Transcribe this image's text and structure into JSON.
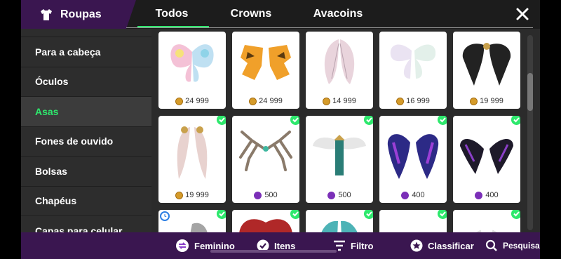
{
  "header": {
    "brand_label": "Roupas",
    "tabs": [
      {
        "label": "Todos",
        "active": true
      },
      {
        "label": "Crowns",
        "active": false
      },
      {
        "label": "Avacoins",
        "active": false
      }
    ],
    "accent_color": "#2ee86d",
    "brand_color": "#3a1650"
  },
  "sidebar": {
    "items": [
      {
        "label": "Para a cabeça",
        "active": false
      },
      {
        "label": "Óculos",
        "active": false
      },
      {
        "label": "Asas",
        "active": true
      },
      {
        "label": "Fones de ouvido",
        "active": false
      },
      {
        "label": "Bolsas",
        "active": false
      },
      {
        "label": "Chapéus",
        "active": false
      },
      {
        "label": "Capas para celular",
        "active": false
      }
    ]
  },
  "items": [
    {
      "price": "24 999",
      "currency": "coin",
      "owned": false,
      "art": "butterfly-wings-pastel"
    },
    {
      "price": "24 999",
      "currency": "coin",
      "owned": false,
      "art": "crystal-wings-orange"
    },
    {
      "price": "14 999",
      "currency": "coin",
      "owned": false,
      "art": "fairy-wings-pink"
    },
    {
      "price": "16 999",
      "currency": "coin",
      "owned": false,
      "art": "fairy-wings-iridescent"
    },
    {
      "price": "19 999",
      "currency": "coin",
      "owned": false,
      "art": "dark-feather-wings"
    },
    {
      "price": "19 999",
      "currency": "coin",
      "owned": true,
      "art": "white-feather-wings"
    },
    {
      "price": "500",
      "currency": "crown",
      "owned": true,
      "art": "branch-wings-white"
    },
    {
      "price": "500",
      "currency": "crown",
      "owned": true,
      "art": "angel-wings-teal"
    },
    {
      "price": "400",
      "currency": "crown",
      "owned": true,
      "art": "purple-blue-wings"
    },
    {
      "price": "400",
      "currency": "crown",
      "owned": true,
      "art": "black-purple-wings"
    },
    {
      "price": "",
      "currency": "",
      "owned": true,
      "timed": true,
      "art": "silver-wings"
    },
    {
      "price": "",
      "currency": "",
      "owned": true,
      "art": "red-bat-wings"
    },
    {
      "price": "",
      "currency": "",
      "owned": true,
      "art": "teal-wings"
    },
    {
      "price": "",
      "currency": "",
      "owned": true,
      "art": "white-wings"
    },
    {
      "price": "",
      "currency": "",
      "owned": true,
      "art": "pale-wings"
    }
  ],
  "bottom_bar": {
    "gender_label": "Feminino",
    "items_label": "Itens",
    "filter_label": "Filtro",
    "sort_label": "Classificar",
    "search_label": "Pesquisa"
  }
}
